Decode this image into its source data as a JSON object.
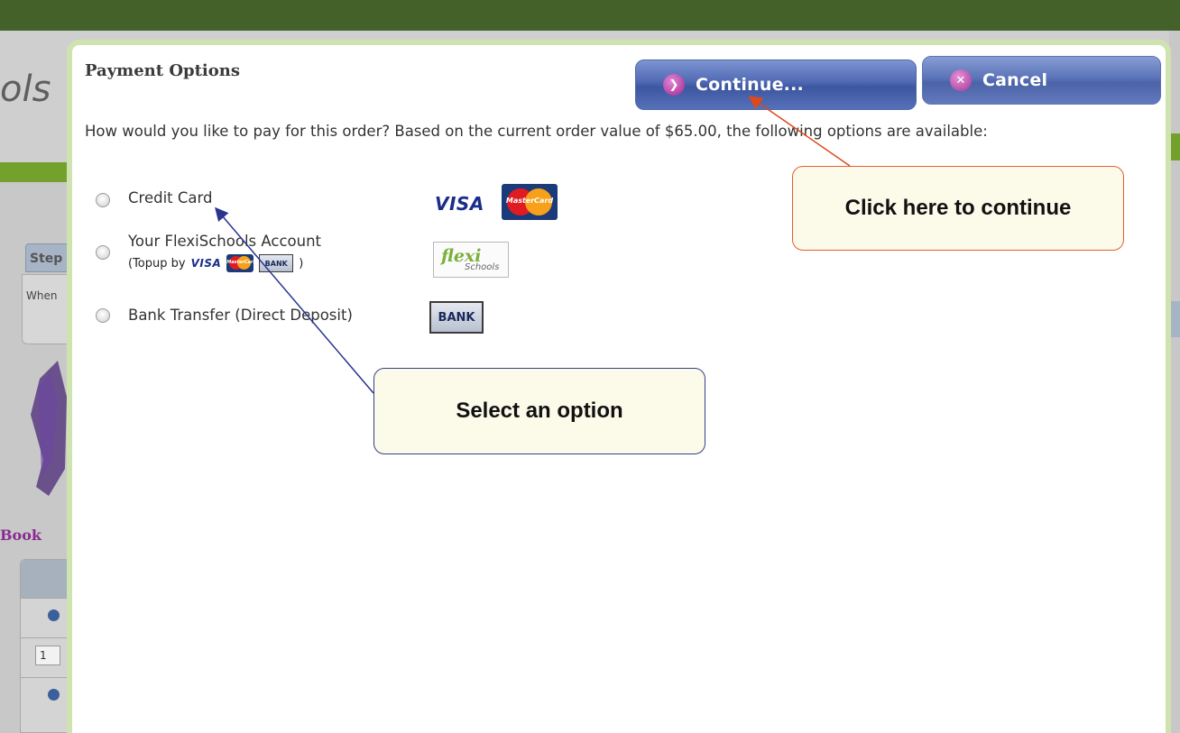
{
  "background": {
    "logo_fragment": "ols",
    "step_tab_label": "Step",
    "step_text_fragment": "When",
    "book_label_fragment": "Book",
    "table_qty_value": "1"
  },
  "modal": {
    "title": "Payment Options",
    "continue_label": "Continue...",
    "cancel_label": "Cancel",
    "question": "How would you like to pay for this order? Based on the current order value of $65.00, the following options are available:",
    "options": [
      {
        "label": "Credit Card",
        "logos": [
          "VISA",
          "MasterCard"
        ]
      },
      {
        "label": "Your FlexiSchools Account",
        "sub_prefix": "(Topup by",
        "sub_suffix": ")",
        "sub_logos": [
          "VISA",
          "MasterCard",
          "BANK"
        ],
        "logo_main": "flexi",
        "logo_sub": "Schools"
      },
      {
        "label": "Bank Transfer (Direct Deposit)",
        "logos": [
          "BANK"
        ]
      }
    ]
  },
  "logos": {
    "visa": "VISA",
    "mastercard": "MasterCard",
    "bank": "BANK"
  },
  "callouts": {
    "continue_hint": "Click here to continue",
    "select_hint": "Select an option"
  },
  "colors": {
    "top_bar": "#44612a",
    "accent_green": "#74a12c",
    "modal_border": "#cfe3b1",
    "button_blue": "#4e68b3",
    "arrow_orange": "#e0481a",
    "arrow_blue": "#2a3590",
    "callout_bg": "#fcfae9"
  }
}
